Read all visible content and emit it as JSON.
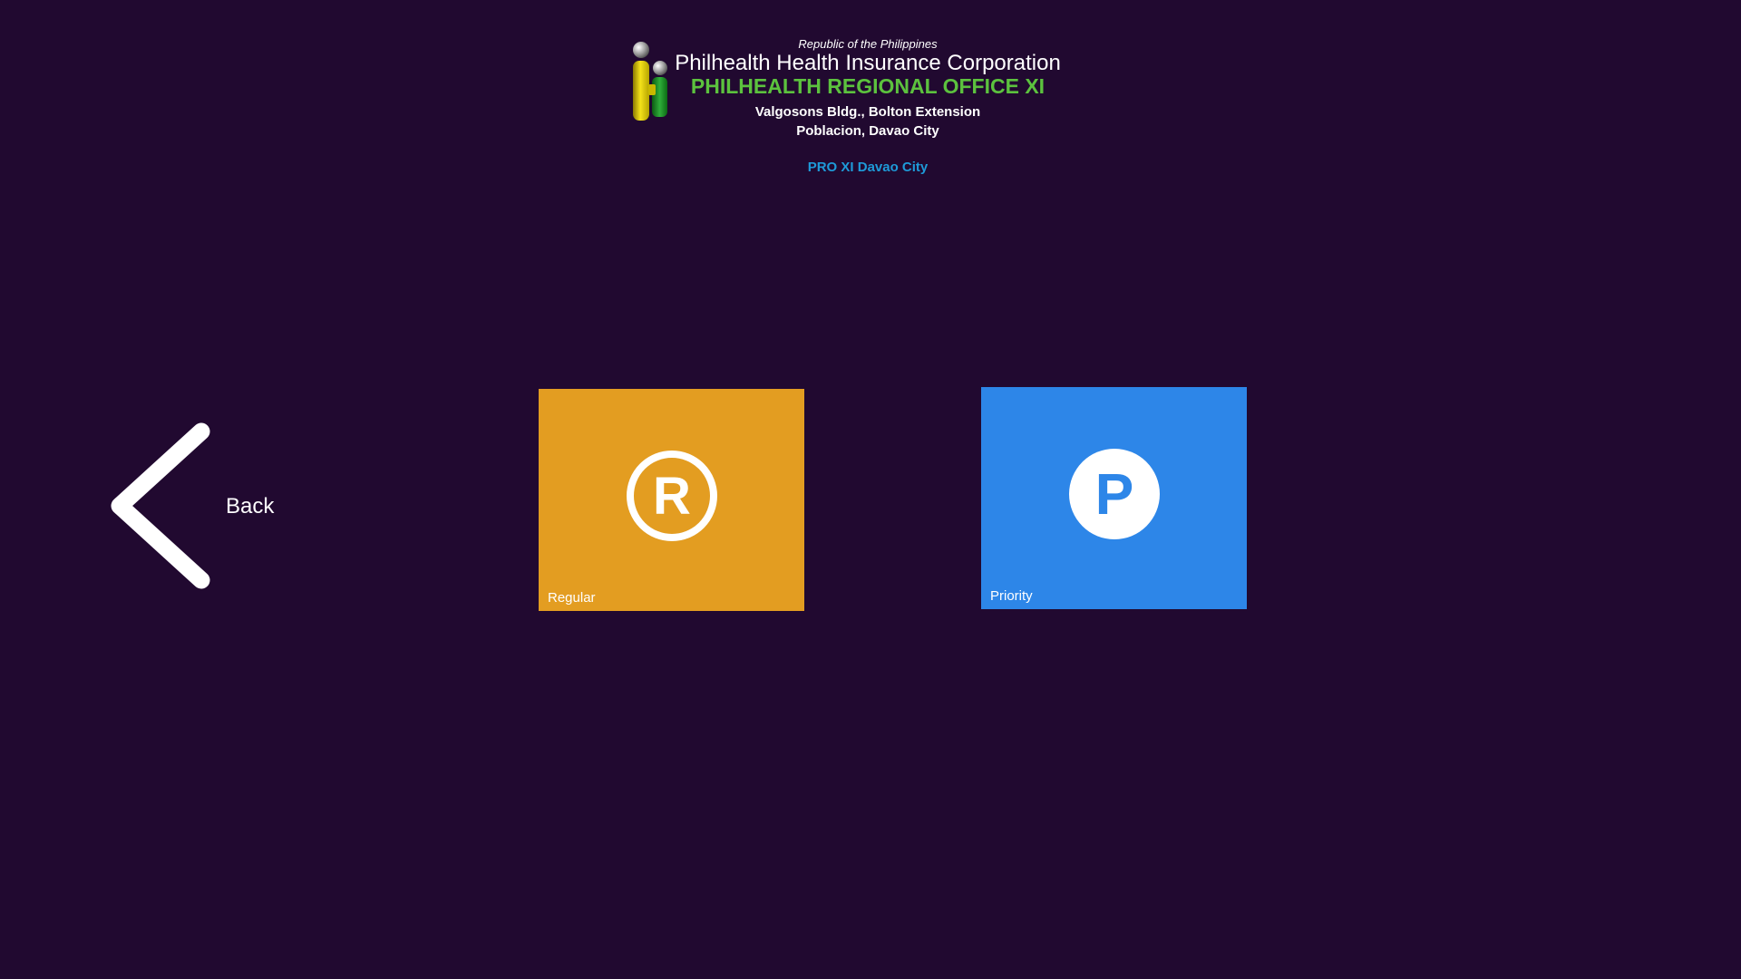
{
  "header": {
    "republic": "Republic of the Philippines",
    "corporation": "Philhealth Health Insurance Corporation",
    "regional_office": "PHILHEALTH REGIONAL OFFICE XI",
    "address_line1": "Valgosons Bldg., Bolton Extension",
    "address_line2": "Poblacion, Davao City",
    "branch": "PRO XI Davao City",
    "logo_icon": "philhealth-logo-icon"
  },
  "navigation": {
    "back_label": "Back",
    "back_icon": "chevron-left-icon"
  },
  "tiles": [
    {
      "label": "Regular",
      "icon": "registered-circle-icon",
      "glyph": "R",
      "color": "#E39D21"
    },
    {
      "label": "Priority",
      "icon": "parking-circle-icon",
      "glyph": "P",
      "color": "#2D86E8"
    }
  ],
  "colors": {
    "background": "#210930",
    "regional_office_text": "#5CC23E",
    "branch_text": "#1E9AD8"
  }
}
